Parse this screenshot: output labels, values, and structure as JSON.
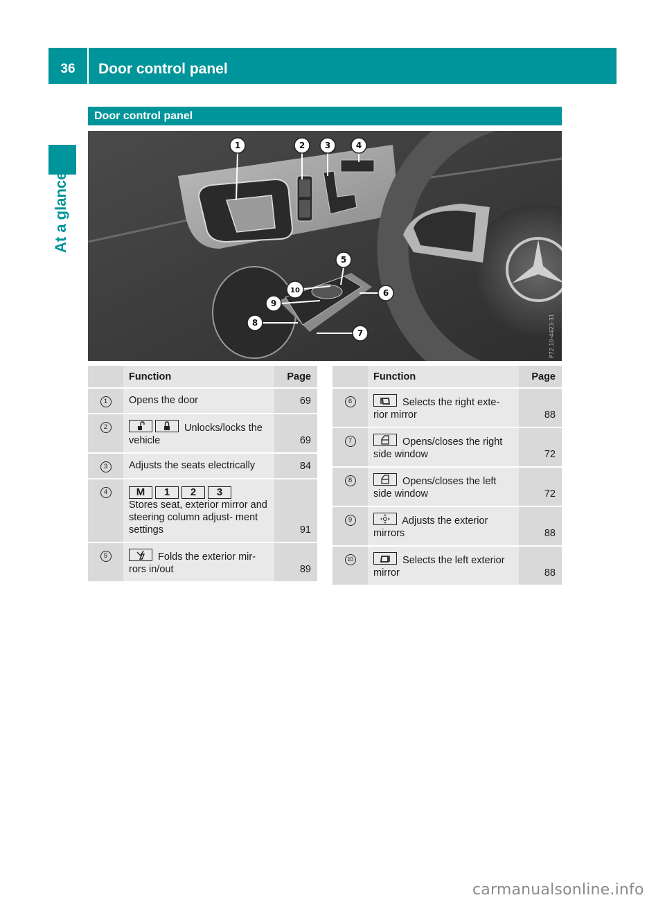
{
  "header": {
    "page_number": "36",
    "title": "Door control panel"
  },
  "side_tab": {
    "label": "At a glance"
  },
  "section": {
    "title": "Door control panel"
  },
  "figure": {
    "image_code": "P72.10-4423-31",
    "callouts": [
      "1",
      "2",
      "3",
      "4",
      "5",
      "6",
      "7",
      "8",
      "9",
      "10"
    ]
  },
  "table_headers": {
    "function": "Function",
    "page": "Page"
  },
  "left_table": [
    {
      "num": "1",
      "icons": [],
      "text": "Opens the door",
      "page": "69"
    },
    {
      "num": "2",
      "icons": [
        "unlock-icon",
        "lock-icon"
      ],
      "text": "Unlocks/locks the vehicle",
      "page": "69"
    },
    {
      "num": "3",
      "icons": [],
      "text": "Adjusts the seats electrically",
      "page": "84"
    },
    {
      "num": "4",
      "icons": [
        "M",
        "1",
        "2",
        "3"
      ],
      "text": "Stores seat, exterior mirror and steering column adjust- ment settings",
      "page": "91"
    },
    {
      "num": "5",
      "icons": [
        "fold-mirror-icon"
      ],
      "text": "Folds the exterior mir- rors in/out",
      "page": "89"
    }
  ],
  "right_table": [
    {
      "num": "6",
      "icons": [
        "right-mirror-icon"
      ],
      "text": "Selects the right exte- rior mirror",
      "page": "88"
    },
    {
      "num": "7",
      "icons": [
        "window-icon"
      ],
      "text": "Opens/closes the right side window",
      "page": "72"
    },
    {
      "num": "8",
      "icons": [
        "window-icon"
      ],
      "text": "Opens/closes the left side window",
      "page": "72"
    },
    {
      "num": "9",
      "icons": [
        "mirror-adjust-icon"
      ],
      "text": "Adjusts the exterior mirrors",
      "page": "88"
    },
    {
      "num": "10",
      "icons": [
        "left-mirror-icon"
      ],
      "text": "Selects the left exterior mirror",
      "page": "88"
    }
  ],
  "footer": {
    "watermark": "carmanualsonline.info"
  }
}
